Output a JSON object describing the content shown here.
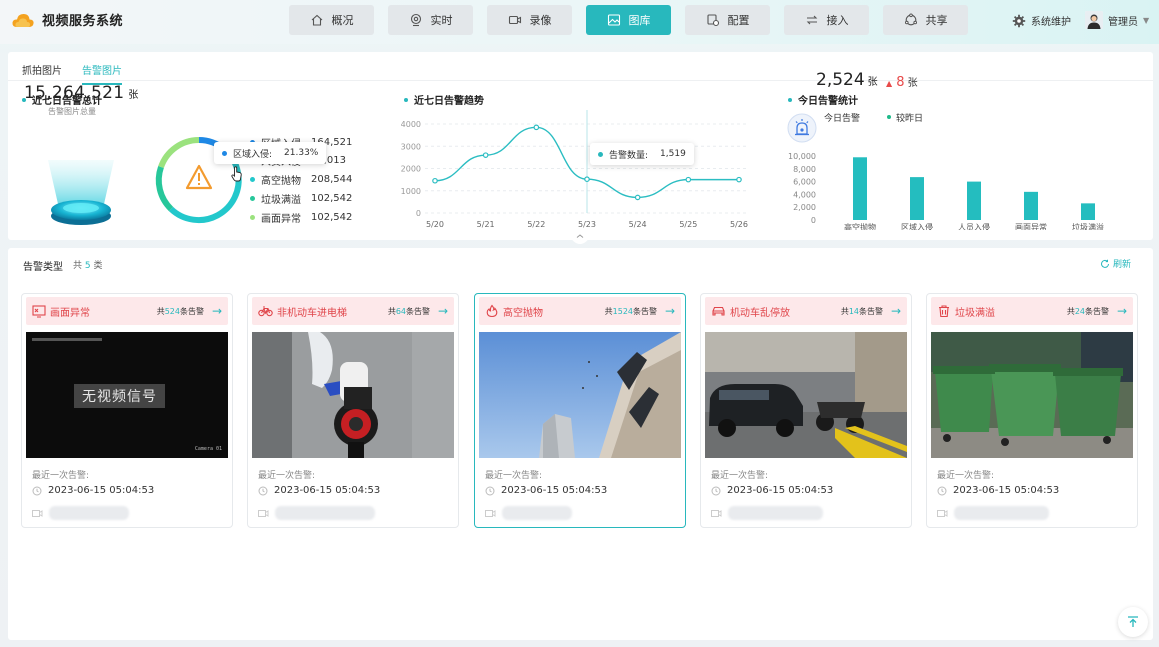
{
  "app": {
    "title": "视频服务系统"
  },
  "nav": [
    {
      "label": "概况",
      "icon": "home-icon"
    },
    {
      "label": "实时",
      "icon": "camera-icon"
    },
    {
      "label": "录像",
      "icon": "video-icon"
    },
    {
      "label": "图库",
      "icon": "image-icon",
      "active": true
    },
    {
      "label": "配置",
      "icon": "config-icon"
    },
    {
      "label": "接入",
      "icon": "access-icon"
    },
    {
      "label": "共享",
      "icon": "share-icon"
    }
  ],
  "header": {
    "system_label": "系统维护",
    "user_label": "管理员"
  },
  "tabs": [
    {
      "label": "抓拍图片"
    },
    {
      "label": "告警图片",
      "active": true
    }
  ],
  "summary": {
    "title": "近七日告警总计",
    "total": "15,264,521",
    "unit": "张",
    "total_label": "告警图片总量",
    "legend": [
      {
        "name": "区域入侵",
        "value": "164,521",
        "color": "#1ea7e0"
      },
      {
        "name": "人员入侵",
        "value": "93,013",
        "color": "#28b8bd"
      },
      {
        "name": "高空抛物",
        "value": "208,544",
        "color": "#35c9a6"
      },
      {
        "name": "垃圾满溢",
        "value": "102,542",
        "color": "#1fba8a"
      },
      {
        "name": "画面异常",
        "value": "102,542",
        "color": "#8ee07f"
      }
    ],
    "tooltip": {
      "name": "区域入侵:",
      "value": "21.33%"
    }
  },
  "trend": {
    "title": "近七日告警趋势",
    "tooltip": {
      "name": "告警数量:",
      "value": "1,519"
    }
  },
  "today": {
    "title": "今日告警统计",
    "today_label": "今日告警",
    "compare_label": "较昨日",
    "today_value": "2,524",
    "today_unit": "张",
    "compare_value": "8",
    "compare_unit": "张"
  },
  "chart_data": [
    {
      "type": "line",
      "x": [
        "5/20",
        "5/21",
        "5/22",
        "5/23",
        "5/24",
        "5/25",
        "5/26"
      ],
      "series": [
        {
          "values": [
            1450,
            2600,
            3850,
            1519,
            700,
            1500,
            1500
          ]
        }
      ],
      "ylim": [
        0,
        4000
      ],
      "yticks": [
        0,
        1000,
        2000,
        3000,
        4000
      ],
      "grid": true
    },
    {
      "type": "bar",
      "categories": [
        "高空抛物",
        "区域入侵",
        "人员入侵",
        "画面异常",
        "垃圾满溢"
      ],
      "values": [
        9800,
        6700,
        6000,
        4400,
        2600
      ],
      "ylim": [
        0,
        10000
      ],
      "yticks": [
        "0",
        "2,000",
        "4,000",
        "6,000",
        "8,000",
        "10,000"
      ]
    }
  ],
  "categories_panel": {
    "title": "告警类型",
    "count_prefix": "共",
    "count": "5",
    "count_suffix": "类",
    "refresh_label": "刷新"
  },
  "cards": [
    {
      "name": "画面异常",
      "icon": "screen-error-icon",
      "cnt_prefix": "共",
      "cnt": "524",
      "cnt_suffix": "条告警",
      "last_label": "最近一次告警:",
      "time": "2023-06-15 05:04:53",
      "no_signal": "无视频信号",
      "overlay_small": "Camera 01"
    },
    {
      "name": "非机动车进电梯",
      "icon": "bicycle-icon",
      "cnt_prefix": "共",
      "cnt": "64",
      "cnt_suffix": "条告警",
      "last_label": "最近一次告警:",
      "time": "2023-06-15 05:04:53"
    },
    {
      "name": "高空抛物",
      "icon": "fire-icon",
      "cnt_prefix": "共",
      "cnt": "1524",
      "cnt_suffix": "条告警",
      "last_label": "最近一次告警:",
      "time": "2023-06-15 05:04:53",
      "active": true
    },
    {
      "name": "机动车乱停放",
      "icon": "car-icon",
      "cnt_prefix": "共",
      "cnt": "14",
      "cnt_suffix": "条告警",
      "last_label": "最近一次告警:",
      "time": "2023-06-15 05:04:53"
    },
    {
      "name": "垃圾满溢",
      "icon": "trash-icon",
      "cnt_prefix": "共",
      "cnt": "24",
      "cnt_suffix": "条告警",
      "last_label": "最近一次告警:",
      "time": "2023-06-15 05:04:53"
    }
  ]
}
